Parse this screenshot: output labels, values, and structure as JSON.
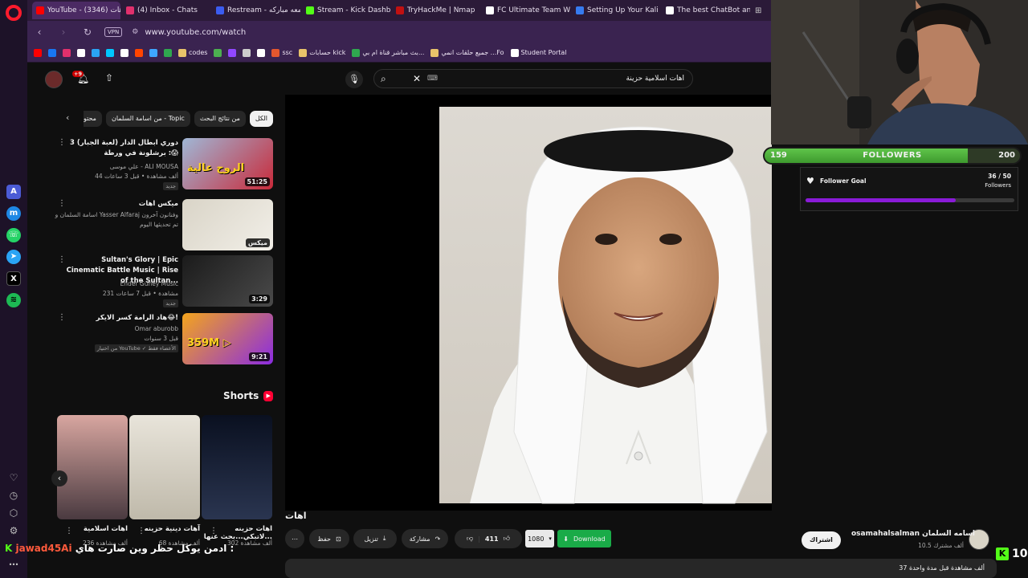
{
  "browser": {
    "tabs": [
      {
        "label": "YouTube - اهات (3346)",
        "color": "#ff0000",
        "active": true
      },
      {
        "label": "(4) Inbox - Chats",
        "color": "#e1306c",
        "active": false
      },
      {
        "label": "Restream - جمعه مباركه",
        "color": "#3b5cf0",
        "active": false
      },
      {
        "label": "Stream - Kick Dashboard",
        "color": "#53fc18",
        "active": false
      },
      {
        "label": "TryHackMe | Nmap",
        "color": "#c11111",
        "active": false
      },
      {
        "label": "FC Ultimate Team Web Ap",
        "color": "#ffffff",
        "active": false
      },
      {
        "label": "Setting Up Your Kali Linux",
        "color": "#367bf0",
        "active": false
      },
      {
        "label": "The best ChatBot and Wid",
        "color": "#ffffff",
        "active": false
      }
    ],
    "url": "www.youtube.com/watch",
    "vpn_label": "VPN",
    "bookmarks": [
      {
        "label": "",
        "color": "#ff0000"
      },
      {
        "label": "",
        "color": "#1877f2"
      },
      {
        "label": "",
        "color": "#e1306c"
      },
      {
        "label": "",
        "color": "#ffffff"
      },
      {
        "label": "",
        "color": "#2aa4f4"
      },
      {
        "label": "",
        "color": "#00c8ff"
      },
      {
        "label": "",
        "color": "#ffffff"
      },
      {
        "label": "",
        "color": "#ff4500"
      },
      {
        "label": "",
        "color": "#3ea6ff"
      },
      {
        "label": "",
        "color": "#2fa84f"
      },
      {
        "label": "codes",
        "color": "#e8c36a"
      },
      {
        "label": "",
        "color": "#4caf50"
      },
      {
        "label": "",
        "color": "#9147ff"
      },
      {
        "label": "",
        "color": "#cccccc"
      },
      {
        "label": "",
        "color": "#ffffff"
      },
      {
        "label": "ssc",
        "color": "#e4572e"
      },
      {
        "label": "حسابات kick",
        "color": "#e8c36a"
      },
      {
        "label": "بث مباشر قناة ام بي...",
        "color": "#2fa84f"
      },
      {
        "label": "جميع حلقات انمي ...Fo",
        "color": "#e8c36a"
      },
      {
        "label": "Student Portal",
        "color": "#ffffff"
      }
    ]
  },
  "youtube": {
    "notification_count": "+9",
    "search_value": "اهات اسلامية حزينة",
    "chips": [
      "الكل",
      "من نتائج البحث",
      "من اسامة السلمان - Topic",
      "محتوى"
    ],
    "recommendations": [
      {
        "title": "دوري ابطال الدار (لعبة الجبار) 3 : برشلونة في ورطة😱",
        "channel": "علي موسى - ALI MOUSA",
        "meta": "44 ألف مشاهدة • قبل 3 ساعات",
        "badge": "جديد",
        "duration": "51:25",
        "thumb_text": "الروح عالية",
        "color1": "#9fb7d6",
        "color2": "#c92a3a"
      },
      {
        "title": "ميكس اهات",
        "channel": "اسامة السلمان و Yasser Alfaraj وفنانون آخرون",
        "meta": "تم تحديثها اليوم",
        "badge": "",
        "duration": "ميكس",
        "thumb_text": "",
        "color1": "#d9d4c7",
        "color2": "#f2efe8"
      },
      {
        "title": "Sultan's Glory | Epic Cinematic Battle Music | Rise of the Sultan...",
        "channel": "Ender Güney Music",
        "meta": "231 مشاهدة • قبل 7 ساعات",
        "badge": "جديد",
        "duration": "3:29",
        "thumb_text": "",
        "color1": "#1b1b1b",
        "color2": "#4a4a4a"
      },
      {
        "title": "هاد الرامة كسر الايكر😂!",
        "channel": "Omar aburobb",
        "meta": "قبل 3 سنوات",
        "badge": "من اختيار YouTube  ✓ الأعضاء فقط",
        "duration": "9:21",
        "thumb_text": "359M ▷",
        "color1": "#f4a51c",
        "color2": "#8a2be2"
      }
    ],
    "shorts_label": "Shorts",
    "shorts": [
      {
        "title": "اهات حزينه لاتبكي...بحث عنها...",
        "meta": "302 ألف مشاهدة",
        "color1": "#0a1020",
        "color2": "#2a3550"
      },
      {
        "title": "آهات دينية حزينه",
        "meta": "68 ألف مشاهدة",
        "color1": "#e8e4da",
        "color2": "#bfb9aa"
      },
      {
        "title": "اهات اسلامية",
        "meta": "236 ألف مشاهدة",
        "color1": "#d8a6a0",
        "color2": "#4a3a40"
      }
    ],
    "video": {
      "title": "اهات",
      "channel_name": "osamahalsalman اسامه السلمان",
      "subscribers": "10.5 ألف مشترك",
      "subscribe_label": "اشتراك",
      "likes": "411",
      "share_label": "مشاركة",
      "download_label": "تنزيل",
      "save_label": "حفظ",
      "quality": "1080",
      "ext_download_label": "Download",
      "views_meta": "37 ألف مشاهدة  قبل مدة واحدة"
    }
  },
  "stream_overlay": {
    "followers_current": "159",
    "followers_label": "FOLLOWERS",
    "followers_target": "200",
    "followers_fraction": 0.795,
    "goal_title": "Follower Goal",
    "goal_count": "36 / 50",
    "goal_unit": "Followers",
    "goal_fraction": 0.72,
    "chat_user": "jawad45Ai",
    "chat_message": "ادمن يوكل حظر وين صارت هاي :",
    "kick_viewers": "10"
  }
}
